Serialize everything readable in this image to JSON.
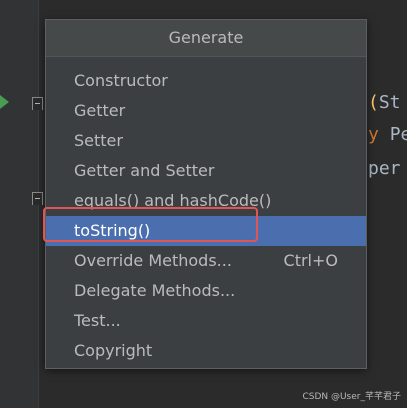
{
  "popup": {
    "title": "Generate",
    "items": [
      {
        "label": "Constructor",
        "shortcut": ""
      },
      {
        "label": "Getter",
        "shortcut": ""
      },
      {
        "label": "Setter",
        "shortcut": ""
      },
      {
        "label": "Getter and Setter",
        "shortcut": ""
      },
      {
        "label": "equals() and hashCode()",
        "shortcut": ""
      },
      {
        "label": "toString()",
        "shortcut": "",
        "selected": true
      },
      {
        "label": "Override Methods...",
        "shortcut": "Ctrl+O"
      },
      {
        "label": "Delegate Methods...",
        "shortcut": ""
      },
      {
        "label": "Test...",
        "shortcut": ""
      },
      {
        "label": "Copyright",
        "shortcut": ""
      }
    ]
  },
  "editor": {
    "code_fragments": {
      "line1_paren": "(",
      "line1_text": "St",
      "line2_keyword": "y",
      "line2_text": "Pe",
      "line3_text": "per"
    }
  },
  "watermark": "CSDN @User_芊芊君子",
  "colors": {
    "selection": "#4b6eaf",
    "highlight_border": "#e05555",
    "run_icon": "#499c54"
  }
}
